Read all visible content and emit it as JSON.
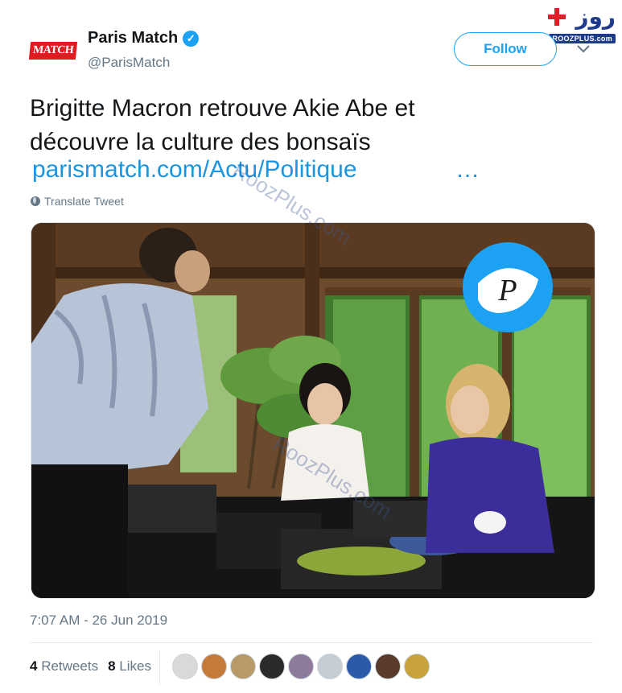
{
  "site_badge": {
    "glyphs": "روز",
    "url": "ROOZPLUS.com"
  },
  "account": {
    "name": "Paris Match",
    "handle": "@ParisMatch",
    "logo_text": "MATCH",
    "verified": true
  },
  "actions": {
    "follow_label": "Follow"
  },
  "tweet": {
    "line1": "Brigitte Macron retrouve Akie Abe et",
    "line2": "découvre la culture des bonsaïs",
    "link": "parismatch.com/Actu/Politique",
    "ellipsis": "…",
    "translate_label": "Translate Tweet"
  },
  "photo": {
    "overlay_letter": "P"
  },
  "watermarks": [
    "RoozPlus.com",
    "RoozPlus.com"
  ],
  "footer": {
    "timestamp": "7:07 AM - 26 Jun 2019",
    "retweets_count": "4",
    "retweets_label": "Retweets",
    "likes_count": "8",
    "likes_label": "Likes"
  },
  "likers": [
    {
      "name": "liker-1",
      "color": "#d9d9d9"
    },
    {
      "name": "liker-2",
      "color": "#c47a3a"
    },
    {
      "name": "liker-3",
      "color": "#b89a6a"
    },
    {
      "name": "liker-4",
      "color": "#2b2b2b"
    },
    {
      "name": "liker-5",
      "color": "#8e7a9a"
    },
    {
      "name": "liker-6",
      "color": "#c5ccd3"
    },
    {
      "name": "liker-7",
      "color": "#2a5aa8"
    },
    {
      "name": "liker-8",
      "color": "#5a3a2a"
    },
    {
      "name": "liker-9",
      "color": "#c8a23a"
    }
  ],
  "colors": {
    "accent": "#1da1f2",
    "link": "#1b95e0",
    "brand": "#e01b22",
    "muted": "#657786"
  }
}
